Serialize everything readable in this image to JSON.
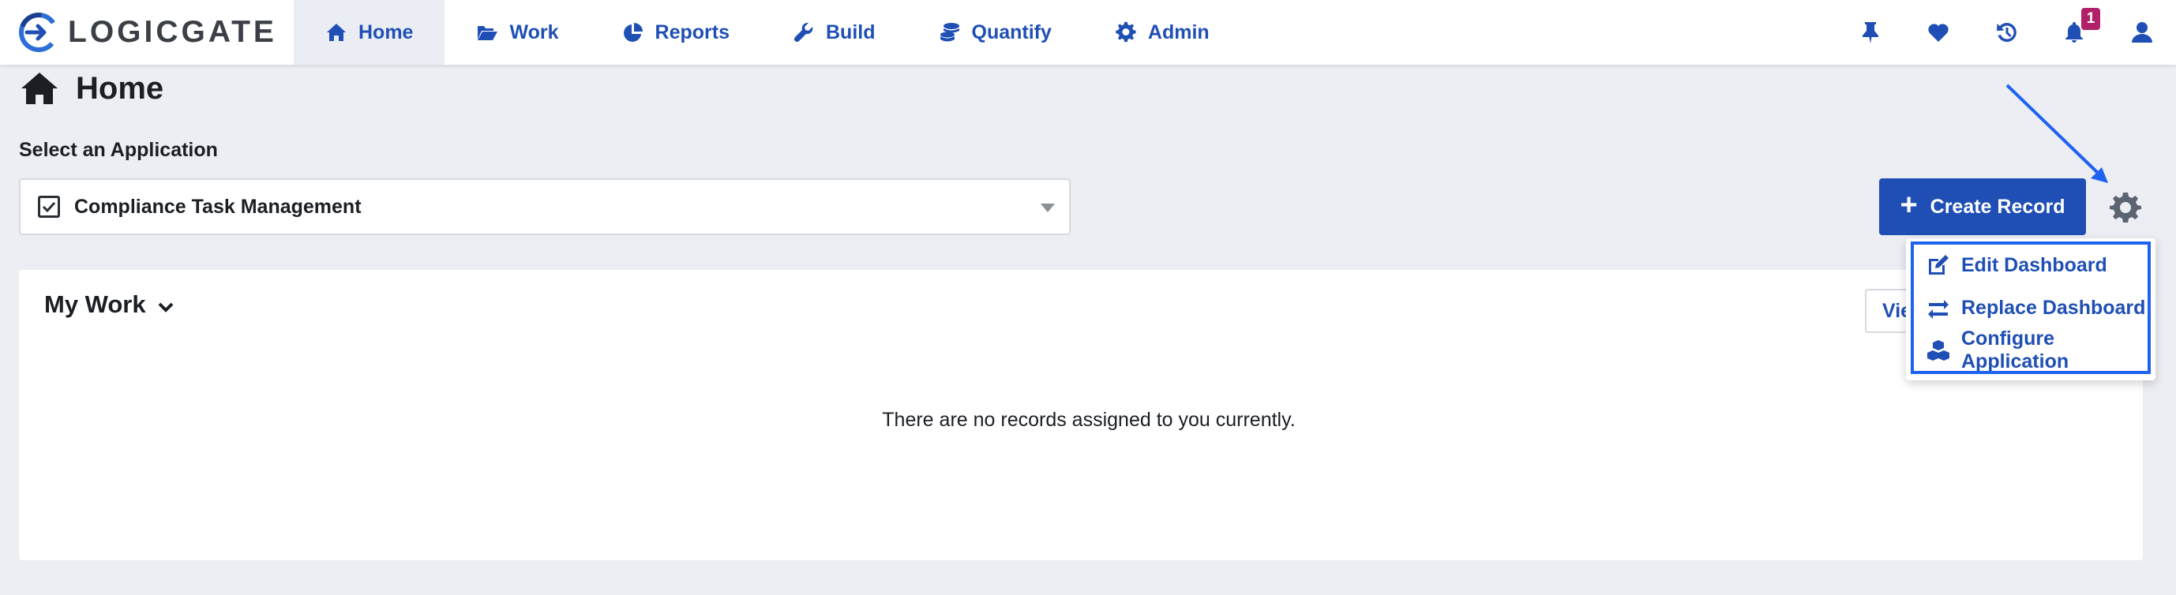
{
  "brand": {
    "name": "LOGICGATE",
    "color": "#1f4fb5"
  },
  "nav": {
    "items": [
      {
        "label": "Home",
        "icon": "home-icon",
        "active": true
      },
      {
        "label": "Work",
        "icon": "folder-open-icon"
      },
      {
        "label": "Reports",
        "icon": "pie-chart-icon"
      },
      {
        "label": "Build",
        "icon": "wrench-icon"
      },
      {
        "label": "Quantify",
        "icon": "coins-icon"
      },
      {
        "label": "Admin",
        "icon": "gear-icon"
      }
    ],
    "right_icons": [
      "thumbtack-icon",
      "heart-icon",
      "history-icon",
      "bell-icon",
      "user-icon"
    ],
    "notification_count": "1"
  },
  "page": {
    "title": "Home",
    "select_label": "Select an Application",
    "selected_application": "Compliance Task Management",
    "create_record_label": "Create Record"
  },
  "work": {
    "title": "My Work",
    "view_button_label": "View",
    "empty_message": "There are no records assigned to you currently."
  },
  "settings_menu": {
    "items": [
      {
        "label": "Edit Dashboard",
        "icon": "edit-icon"
      },
      {
        "label": "Replace Dashboard",
        "icon": "swap-icon"
      },
      {
        "label": "Configure Application",
        "icon": "cubes-icon"
      }
    ]
  },
  "annotation": {
    "highlight_color": "#1f62f0"
  }
}
